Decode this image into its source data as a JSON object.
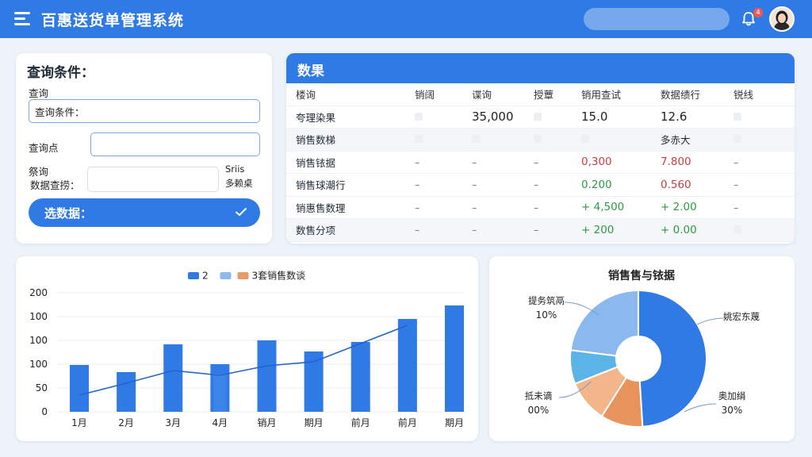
{
  "header": {
    "title": "百惠送货单管理系统",
    "notification_count": "4",
    "menu_icon": "hamburger-menu-icon",
    "bell_icon": "bell-icon",
    "accent": "#2f7ae5"
  },
  "query": {
    "title": "查询条件：",
    "label_1": "查询",
    "input_1_value": "查询条件：",
    "label_2": "查询点",
    "input_2_value": "",
    "label_3a": "祭询",
    "label_3b": "数据查捞：",
    "side_note_a": "Sriis",
    "side_note_b": "多赖桌",
    "input_3_value": "",
    "submit_label": "选数据："
  },
  "results": {
    "title": "数果",
    "columns": [
      "楼询",
      "销阔",
      "谍询",
      "授蕈",
      "销用查试",
      "数据绩行",
      "锐线"
    ],
    "rows": [
      {
        "cells": [
          "夸理染果",
          "box",
          "35,000",
          "box",
          "15.0",
          "12.6",
          "box"
        ],
        "styles": [
          "",
          "box",
          "big",
          "box",
          "big",
          "big",
          "box"
        ]
      },
      {
        "cells": [
          "销售数梯",
          "box",
          "box",
          "box",
          "box",
          "多赤大",
          "box"
        ],
        "styles": [
          "",
          "box",
          "box",
          "box",
          "box",
          "",
          "box"
        ],
        "band": true
      },
      {
        "cells": [
          "销售铱据",
          "–",
          "–",
          "–",
          "0,300",
          "7.800",
          "–"
        ],
        "styles": [
          "",
          "dash",
          "dash",
          "dash",
          "red",
          "red",
          "dash"
        ]
      },
      {
        "cells": [
          "销售球潮行",
          "–",
          "–",
          "–",
          "0.200",
          "0.560",
          "–"
        ],
        "styles": [
          "",
          "dash",
          "dash",
          "dash",
          "green",
          "red",
          "dash"
        ]
      },
      {
        "cells": [
          "销惠售数理",
          "–",
          "–",
          "–",
          "+ 4,500",
          "+ 2.00",
          "–"
        ],
        "styles": [
          "",
          "dash",
          "dash",
          "dash",
          "green",
          "green",
          "dash"
        ]
      },
      {
        "cells": [
          "数售分项",
          "–",
          "–",
          "–",
          "+ 200",
          "+ 0.00",
          "box"
        ],
        "styles": [
          "",
          "dash",
          "dash",
          "dash",
          "green",
          "green",
          "box"
        ],
        "band": true
      }
    ]
  },
  "chart_data": [
    {
      "type": "bar",
      "legend": [
        {
          "name": "2",
          "color": "#2f7ae5"
        },
        {
          "name": "",
          "color": "#8ab8ef"
        },
        {
          "name": "3套销售数谈",
          "color": "#e99a6a"
        }
      ],
      "legend_position": "top-center",
      "categories": [
        "1月",
        "2月",
        "3月",
        "4月",
        "销月",
        "期月",
        "前月",
        "前月",
        "期月"
      ],
      "y_tick_labels": [
        "200",
        "100",
        "100",
        "100",
        "50",
        "0"
      ],
      "series": [
        {
          "name": "2",
          "type": "bar",
          "values": [
            59,
            50,
            85,
            60,
            90,
            76,
            88,
            117,
            134
          ]
        },
        {
          "name": "",
          "type": "bar",
          "values": [
            null,
            null,
            null,
            48,
            null,
            null,
            null,
            null,
            null
          ]
        },
        {
          "name": "",
          "type": "line",
          "values": [
            21,
            36,
            52,
            46,
            58,
            63,
            null,
            109,
            null
          ]
        }
      ],
      "ylim": [
        0,
        150
      ],
      "grid": true
    },
    {
      "type": "pie",
      "title": "销售售与铱据",
      "donut": true,
      "slices": [
        {
          "label": "",
          "value": 10,
          "color": "#e9935c"
        },
        {
          "label": "",
          "value": 10,
          "color": "#f3b58a"
        },
        {
          "label": "",
          "value": 8,
          "color": "#5ab4e5"
        },
        {
          "label": "",
          "value": 23,
          "color": "#8ab8ef"
        },
        {
          "label": "",
          "value": 49,
          "color": "#2f7ae5"
        }
      ],
      "annotations": [
        {
          "name": "提务筑鬲",
          "pct": "10%"
        },
        {
          "name": "姚宏东蔑",
          "pct": ""
        },
        {
          "name": "抵未谪",
          "pct": "00%"
        },
        {
          "name": "奥加绢",
          "pct": "30%"
        }
      ]
    }
  ]
}
